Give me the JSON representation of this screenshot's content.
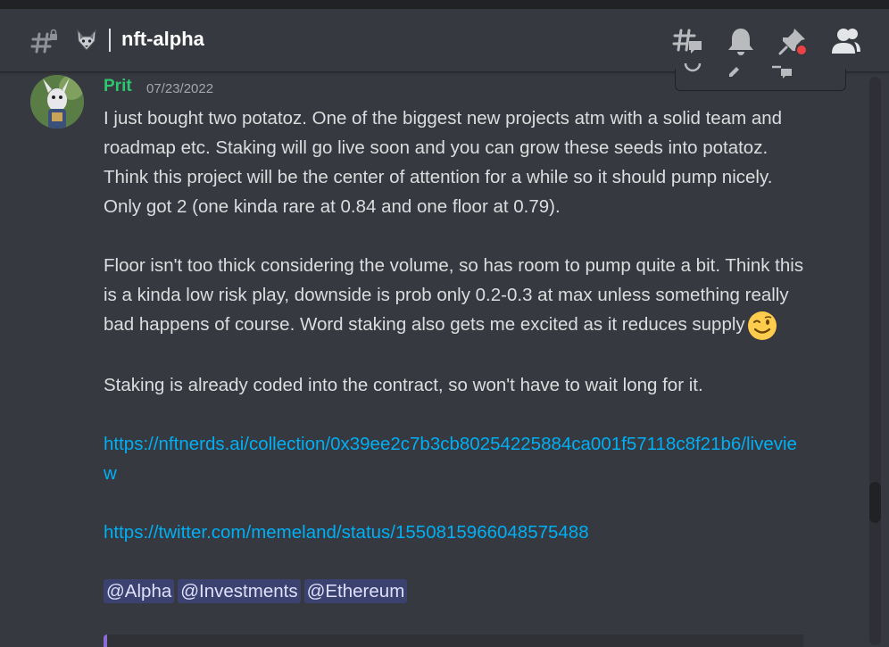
{
  "header": {
    "channel_name": "nft-alpha",
    "icons": [
      "channel-hash-lock-icon",
      "wolf-emoji-icon",
      "threads-icon",
      "notification-bell-icon",
      "pinned-messages-icon",
      "member-list-icon"
    ]
  },
  "message": {
    "username": "Prit",
    "timestamp": "07/23/2022",
    "username_color": "#2dc770",
    "lines": {
      "p1": "I just bought two potatoz. One of the biggest new projects atm with a solid team and roadmap etc. Staking will go live soon and you can grow these seeds into potatoz. Think this project will be the center of attention for a while so it should pump nicely. Only got 2 (one kinda rare at 0.84 and one floor at 0.79).",
      "p2": "Floor isn't too thick considering the volume, so has room to pump quite a bit. Think this is a kinda low risk play, downside is prob only 0.2-0.3 at max unless something really bad happens of course. Word staking also gets me excited as it reduces supply",
      "p3": "Staking is already coded into the contract, so won't have to wait long for it.",
      "link1": "https://nftnerds.ai/collection/0x39ee2c7b3cb80254225884ca001f57118c8f21b6/liveview",
      "link2": "https://twitter.com/memeland/status/1550815966048575488"
    },
    "mentions": [
      "@Alpha",
      "@Investments",
      "@Ethereum"
    ],
    "emoji": "winking-face-emoji"
  },
  "colors": {
    "background": "#36393f",
    "link": "#00aff4",
    "mention_bg": "#3c4270",
    "embed_accent": "#8e6ad8"
  }
}
